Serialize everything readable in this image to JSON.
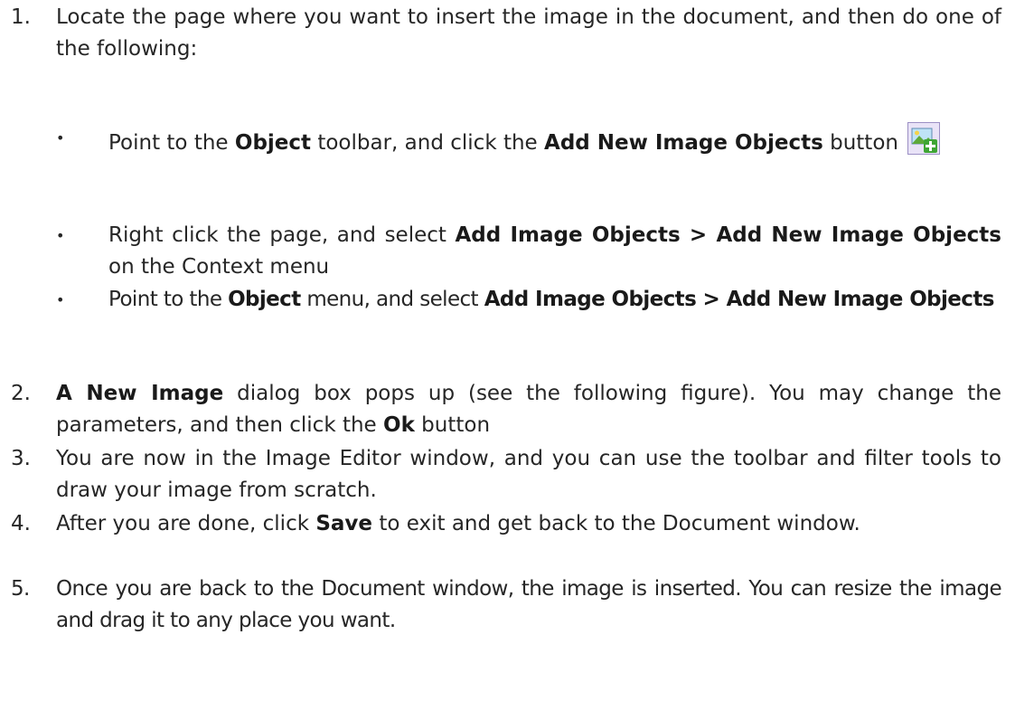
{
  "steps": [
    {
      "number": "1.",
      "text_a": "Locate the page where you want to insert the image in the document, and then do one of the following:"
    },
    {
      "number": "2.",
      "bold_a": "A New Image",
      "text_a": " dialog box pops up (see the following figure). You may change the parameters, and then click the ",
      "bold_b": "Ok",
      "text_b": " button"
    },
    {
      "number": "3.",
      "text_a": "You are now in the Image Editor window, and you can use the toolbar and filter tools to draw your image from scratch."
    },
    {
      "number": "4.",
      "text_a": "After you are done, click ",
      "bold_a": "Save",
      "text_b": " to exit and get back to the Document window."
    },
    {
      "number": "5.",
      "text_a": "Once you are back to the Document window, the image is inserted. You can resize the image and drag it to any place you want."
    }
  ],
  "bullets": [
    {
      "symbol": "•",
      "text_a": "Point to the ",
      "bold_a": "Object",
      "text_b": " toolbar, and click the ",
      "bold_b": "Add New Image Objects",
      "text_c": " button",
      "icon": "add-image-object-icon"
    },
    {
      "symbol": "•",
      "text_a": "Right click the page, and select ",
      "bold_a": "Add Image Objects > Add New Image Objects",
      "text_b": " on the Context menu"
    },
    {
      "symbol": "•",
      "text_a": "Point to the ",
      "bold_a": "Object",
      "text_b": " menu, and select ",
      "bold_b": "Add Image Objects > Add New Image Objects"
    }
  ],
  "colors": {
    "text": "#262626",
    "icon_border": "#9b8fc4",
    "icon_bg": "#e9e3f7",
    "plus_green": "#3fa535"
  }
}
